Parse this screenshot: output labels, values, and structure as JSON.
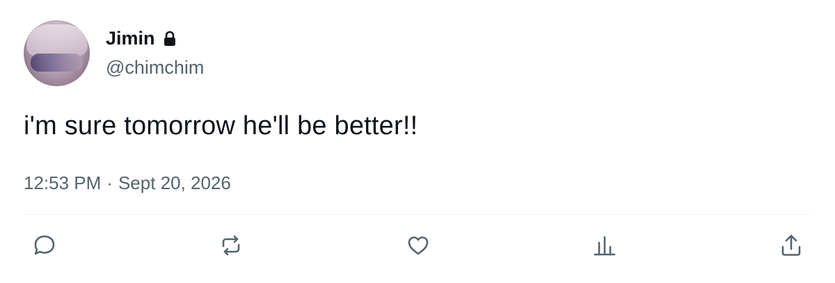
{
  "tweet": {
    "author": {
      "display_name": "Jimin",
      "handle": "@chimchim",
      "protected_icon": "lock-icon"
    },
    "text": "i'm sure tomorrow he'll be better!!",
    "time": "12:53 PM",
    "separator": "·",
    "date": "Sept 20, 2026"
  },
  "actions": [
    {
      "name": "reply",
      "icon": "reply-icon"
    },
    {
      "name": "retweet",
      "icon": "retweet-icon"
    },
    {
      "name": "like",
      "icon": "heart-icon"
    },
    {
      "name": "views",
      "icon": "analytics-icon"
    },
    {
      "name": "share",
      "icon": "share-icon"
    }
  ],
  "colors": {
    "text_primary": "#0f1419",
    "text_secondary": "#536471",
    "divider": "#eff3f4"
  }
}
